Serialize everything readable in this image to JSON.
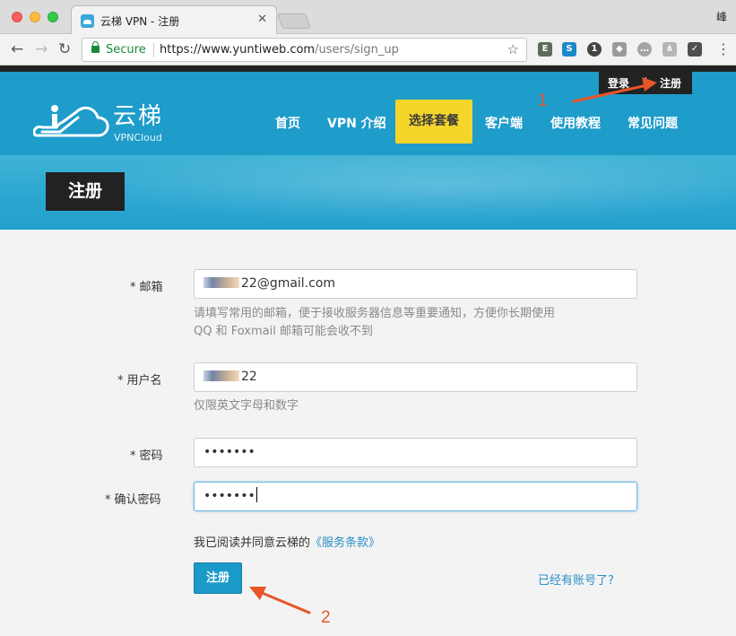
{
  "browser": {
    "tab_title": "云梯 VPN - 注册",
    "profile_char": "峰",
    "secure_label": "Secure",
    "url_host": "https://www.yuntiweb.com",
    "url_path": "/users/sign_up"
  },
  "header": {
    "logo_text": "云梯",
    "logo_sub": "VPNCloud",
    "nav": {
      "home": "首页",
      "intro": "VPN 介绍",
      "plan": "选择套餐",
      "client": "客户端",
      "tutorial": "使用教程",
      "faq": "常见问题"
    },
    "auth": {
      "login": "登录",
      "sep": "/",
      "register": "注册"
    }
  },
  "banner": {
    "title": "注册"
  },
  "form": {
    "email": {
      "label": "邮箱",
      "required_mark": "*",
      "value": "22@gmail.com",
      "help_line1": "请填写常用的邮箱，便于接收服务器信息等重要通知，方便你长期使用",
      "help_line2": "QQ 和 Foxmail 邮箱可能会收不到"
    },
    "username": {
      "label": "用户名",
      "required_mark": "*",
      "value": "22",
      "help": "仅限英文字母和数字"
    },
    "password": {
      "label": "密码",
      "required_mark": "*",
      "value": "•••••••"
    },
    "confirm_password": {
      "label": "确认密码",
      "required_mark": "*",
      "value": "•••••••"
    },
    "agree_text": "我已阅读并同意云梯的",
    "agree_link": "《服务条款》",
    "submit_label": "注册",
    "have_account": "已经有账号了?"
  },
  "annotations": {
    "one": "1",
    "two": "2"
  }
}
